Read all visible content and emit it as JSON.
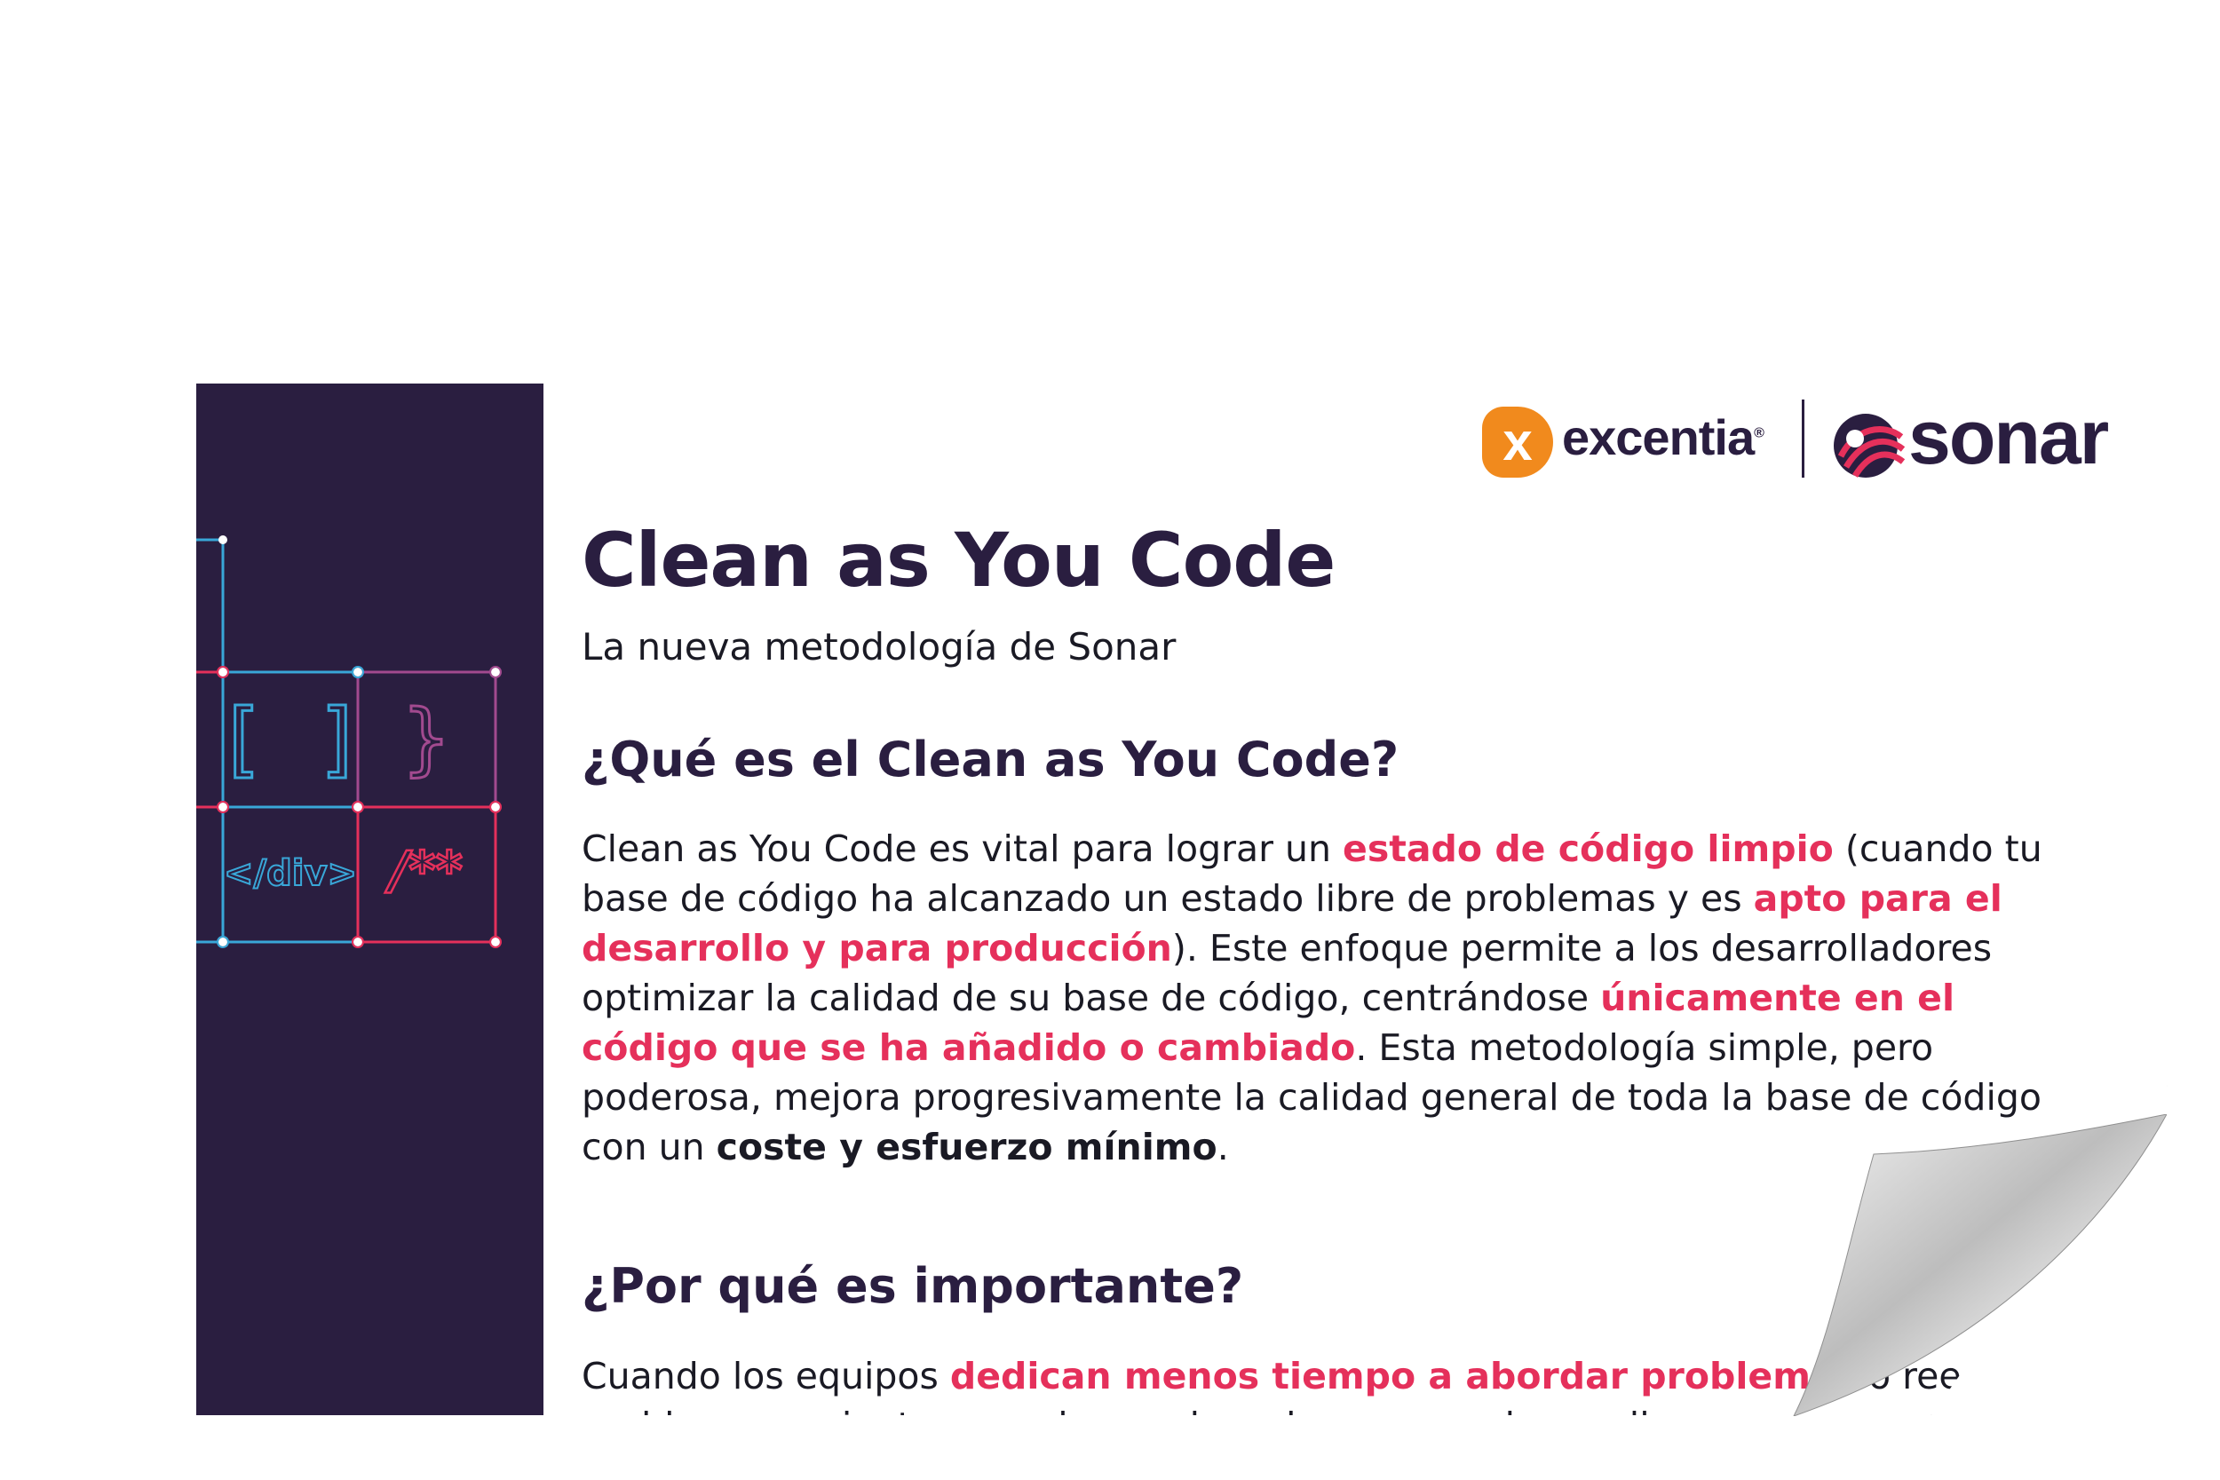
{
  "brand": {
    "excentia_mark": "x",
    "excentia_name": "excentia",
    "excentia_reg": "®",
    "sonar_name": "sonar",
    "colors": {
      "navy": "#2a1e40",
      "pink": "#e5305b",
      "orange": "#f18a1d"
    }
  },
  "sidebar": {
    "glyphs": [
      "[ ]",
      "}",
      "</div>",
      "/**"
    ]
  },
  "doc": {
    "title": "Clean as You Code",
    "subtitle": "La nueva metodología de Sonar",
    "section1": {
      "heading": "¿Qué es el Clean as You Code?",
      "p1": "Clean as You Code es vital para lograr un ",
      "h1": "estado de código limpio",
      "p2": " (cuando tu base de código ha alcanzado un estado libre de problemas y es ",
      "h2": "apto para el desarrollo y para producción",
      "p3": "). Este enfoque permite a los desarrolladores optimizar la calidad de su base de código, centrándose ",
      "h3": "únicamente en el código que se ha añadido o cambiado",
      "p4": ". Esta metodología simple, pero poderosa, mejora progresivamente la calidad general de toda la base de código con un ",
      "b1": "coste y esfuerzo mínimo",
      "p5": "."
    },
    "section2": {
      "heading": "¿Por qué es importante?",
      "p1": "Cuando los equipos ",
      "h1": "dedican menos tiempo a abordar problemas",
      "p2": " o reescribir problemas recientes, pueden acelerar los nuevos desarrollos"
    }
  }
}
